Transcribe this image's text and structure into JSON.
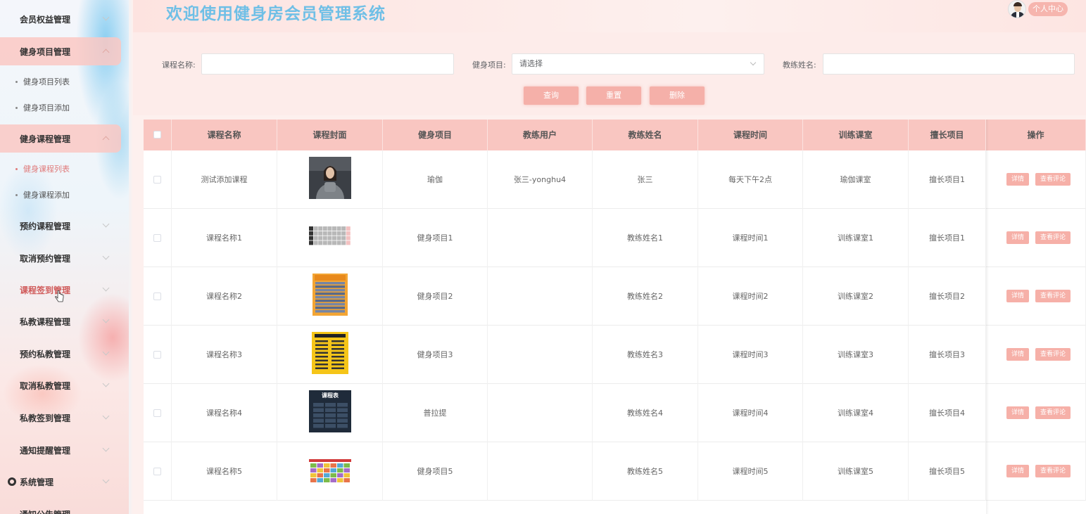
{
  "sidebar": {
    "menus": [
      {
        "label": "会员权益管理",
        "icon": "grid-icon",
        "open": false
      },
      {
        "label": "健身项目管理",
        "icon": "grid-icon",
        "open": true,
        "children": [
          {
            "label": "健身项目列表",
            "active": false
          },
          {
            "label": "健身项目添加",
            "active": false
          }
        ]
      },
      {
        "label": "健身课程管理",
        "icon": "grid-icon",
        "open": true,
        "children": [
          {
            "label": "健身课程列表",
            "active": true
          },
          {
            "label": "健身课程添加",
            "active": false
          }
        ]
      },
      {
        "label": "预约课程管理",
        "icon": "grid-icon"
      },
      {
        "label": "取消预约管理",
        "icon": "grid-icon"
      },
      {
        "label": "课程签到管理",
        "icon": "grid-icon",
        "hovered": true
      },
      {
        "label": "私教课程管理",
        "icon": "grid-icon"
      },
      {
        "label": "预约私教管理",
        "icon": "grid-icon"
      },
      {
        "label": "取消私教管理",
        "icon": "grid-icon"
      },
      {
        "label": "私教签到管理",
        "icon": "grid-icon"
      },
      {
        "label": "通知提醒管理",
        "icon": "grid-icon"
      },
      {
        "label": "系统管理",
        "icon": "gear-icon"
      },
      {
        "label": "通知公告管理",
        "icon": "grid-icon"
      }
    ]
  },
  "header": {
    "title": "欢迎使用健身房会员管理系统",
    "profile_label": "个人中心"
  },
  "search": {
    "course_name_label": "课程名称:",
    "course_name_value": "",
    "project_label": "健身项目:",
    "project_placeholder": "请选择",
    "coach_name_label": "教练姓名:",
    "coach_name_value": "",
    "query_btn": "查询",
    "reset_btn": "重置",
    "delete_btn": "删除"
  },
  "table": {
    "columns": [
      "课程名称",
      "课程封面",
      "健身项目",
      "教练用户",
      "教练姓名",
      "课程时间",
      "训练课室",
      "擅长项目",
      "操作"
    ],
    "detail_btn": "详情",
    "comment_btn": "查看评论",
    "rows": [
      {
        "name": "测试添加课程",
        "cover": "woman-photo",
        "project": "瑜伽",
        "coach_user": "张三-yonghu4",
        "coach_name": "张三",
        "time": "每天下午2点",
        "room": "瑜伽课室",
        "specialty": "擅长项目1"
      },
      {
        "name": "课程名称1",
        "cover": "schedule-grid",
        "project": "健身项目1",
        "coach_user": "",
        "coach_name": "教练姓名1",
        "time": "课程时间1",
        "room": "训练课室1",
        "specialty": "擅长项目1"
      },
      {
        "name": "课程名称2",
        "cover": "orange-schedule",
        "project": "健身项目2",
        "coach_user": "",
        "coach_name": "教练姓名2",
        "time": "课程时间2",
        "room": "训练课室2",
        "specialty": "擅长项目2"
      },
      {
        "name": "课程名称3",
        "cover": "yellow-poster",
        "project": "健身项目3",
        "coach_user": "",
        "coach_name": "教练姓名3",
        "time": "课程时间3",
        "room": "训练课室3",
        "specialty": "擅长项目3"
      },
      {
        "name": "课程名称4",
        "cover": "dark-schedule",
        "project": "普拉提",
        "coach_user": "",
        "coach_name": "教练姓名4",
        "time": "课程时间4",
        "room": "训练课室4",
        "specialty": "擅长项目4"
      },
      {
        "name": "课程名称5",
        "cover": "colorful-schedule",
        "project": "健身项目5",
        "coach_user": "",
        "coach_name": "教练姓名5",
        "time": "课程时间5",
        "room": "训练课室5",
        "specialty": "擅长项目5"
      }
    ],
    "cover_texts": {
      "dark_schedule_title": "课程表"
    }
  },
  "colors": {
    "accent": "#f6b0a8",
    "title_blue": "#6fbfe6",
    "active_menu": "#e07b7b"
  }
}
